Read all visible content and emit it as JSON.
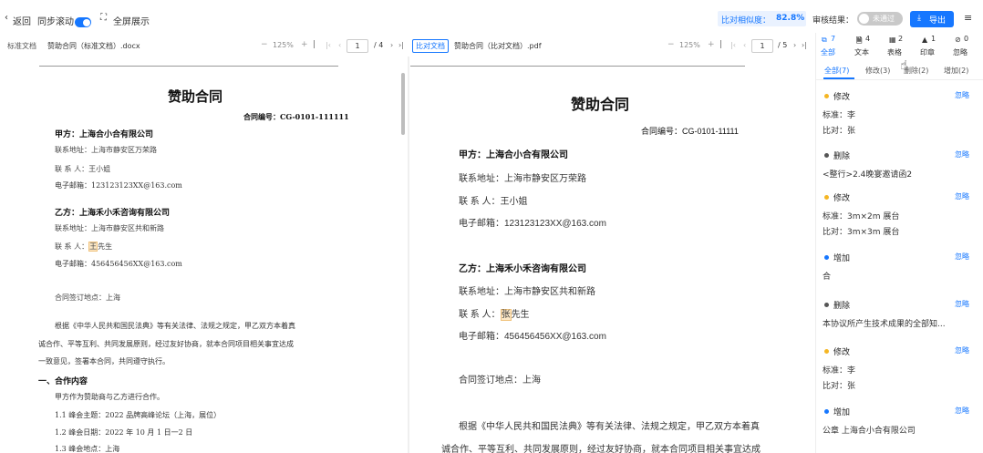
{
  "toolbar": {
    "back_label": "返回",
    "sync_scroll_label": "同步滚动",
    "fullscreen_label": "全屏展示",
    "similarity_label": "比对相似度：",
    "similarity_value": "82.8%",
    "review_label": "审核结果：",
    "review_status": "未通过",
    "export_label": "导出"
  },
  "left_doc": {
    "tag": "标准文档",
    "filename": "赞助合同（标准文档）.docx",
    "zoom": "125%",
    "page_current": "1",
    "page_total": "/ 4"
  },
  "right_doc": {
    "tag": "比对文档",
    "filename": "赞助合同（比对文档）.pdf",
    "zoom": "125%",
    "page_current": "1",
    "page_total": "/ 5"
  },
  "left_page": {
    "title": "赞助合同",
    "contract_no": "合同编号：CG-0101-111111",
    "party_a": "甲方：上海合小合有限公司",
    "a_address": "联系地址：上海市静安区万荣路",
    "a_contact_prefix": "联 系 人：",
    "a_contact": "王小姐",
    "a_email": "电子邮箱：123123123XX@163.com",
    "party_b": "乙方：上海禾小禾咨询有限公司",
    "b_address": "联系地址：上海市静安区共和新路",
    "b_contact_prefix": "联 系 人：",
    "b_contact_mark": "王",
    "b_contact_rest": "先生",
    "b_email": "电子邮箱：456456456XX@163.com",
    "sign_place": "合同签订地点：上海",
    "para1": "根据《中华人民共和国民法典》等有关法律、法规之规定，甲乙双方本着真",
    "para2": "诚合作、平等互利、共同发展原则，经过友好协商，就本合同项目相关事宜达成",
    "para3": "一致意见，签署本合同，共同遵守执行。",
    "section1": "一、合作内容",
    "s1_intro": "甲方作为赞助商与乙方进行合作。",
    "item1": "1.1 峰会主题：2022 品牌高峰论坛（上海，展位）",
    "item2": "1.2 峰会日期：2022 年 10 月 1 日一2 日",
    "item3": "1.3 峰会地点：上海"
  },
  "right_page": {
    "title": "赞助合同",
    "contract_no": "合同编号：CG-0101-11111",
    "party_a": "甲方：上海合小合有限公司",
    "a_address": "联系地址：上海市静安区万荣路",
    "a_contact": "联 系 人：王小姐",
    "a_email": "电子邮箱：123123123XX@163.com",
    "party_b": "乙方：上海禾小禾咨询有限公司",
    "b_address": "联系地址：上海市静安区共和新路",
    "b_contact_prefix": "联 系 人：",
    "b_contact_mark": "张",
    "b_contact_rest": "先生",
    "b_email": "电子邮箱：456456456XX@163.com",
    "sign_place": "合同签订地点：上海",
    "para1": "根据《中华人民共和国民法典》等有关法律、法规之规定，甲乙双方本着真",
    "para2": "诚合作、平等互利、共同发展原则，经过友好协商，就本合同项目相关事宜达成"
  },
  "panel": {
    "categories": [
      {
        "count": "7",
        "label": "全部"
      },
      {
        "count": "4",
        "label": "文本"
      },
      {
        "count": "2",
        "label": "表格"
      },
      {
        "count": "1",
        "label": "印章"
      },
      {
        "count": "0",
        "label": "忽略"
      }
    ],
    "tabs": [
      "全部(7)",
      "修改(3)",
      "删除(2)",
      "增加(2)"
    ],
    "ignore_label": "忽略",
    "items": [
      {
        "type": "修改",
        "color": "#f5b623",
        "lines": [
          "标准：李",
          "比对：张"
        ]
      },
      {
        "type": "删除",
        "color": "#555555",
        "lines": [
          "<整行>2.4晚宴邀请函2"
        ]
      },
      {
        "type": "修改",
        "color": "#f5b623",
        "lines": [
          "标准：3m×2m 展台",
          "比对：3m×3m 展台"
        ]
      },
      {
        "type": "增加",
        "color": "#1677ff",
        "lines": [
          "合"
        ]
      },
      {
        "type": "删除",
        "color": "#555555",
        "lines": [
          "本协议所产生技术成果的全部知..."
        ]
      },
      {
        "type": "修改",
        "color": "#f5b623",
        "lines": [
          "标准：李",
          "比对：张"
        ]
      },
      {
        "type": "增加",
        "color": "#1677ff",
        "lines": [
          "公章 上海合小合有限公司"
        ]
      }
    ]
  },
  "colors": {
    "accent": "#1677ff",
    "highlight": "#fde9c8",
    "modify": "#f5b623",
    "add": "#1677ff",
    "delete": "#555555"
  }
}
